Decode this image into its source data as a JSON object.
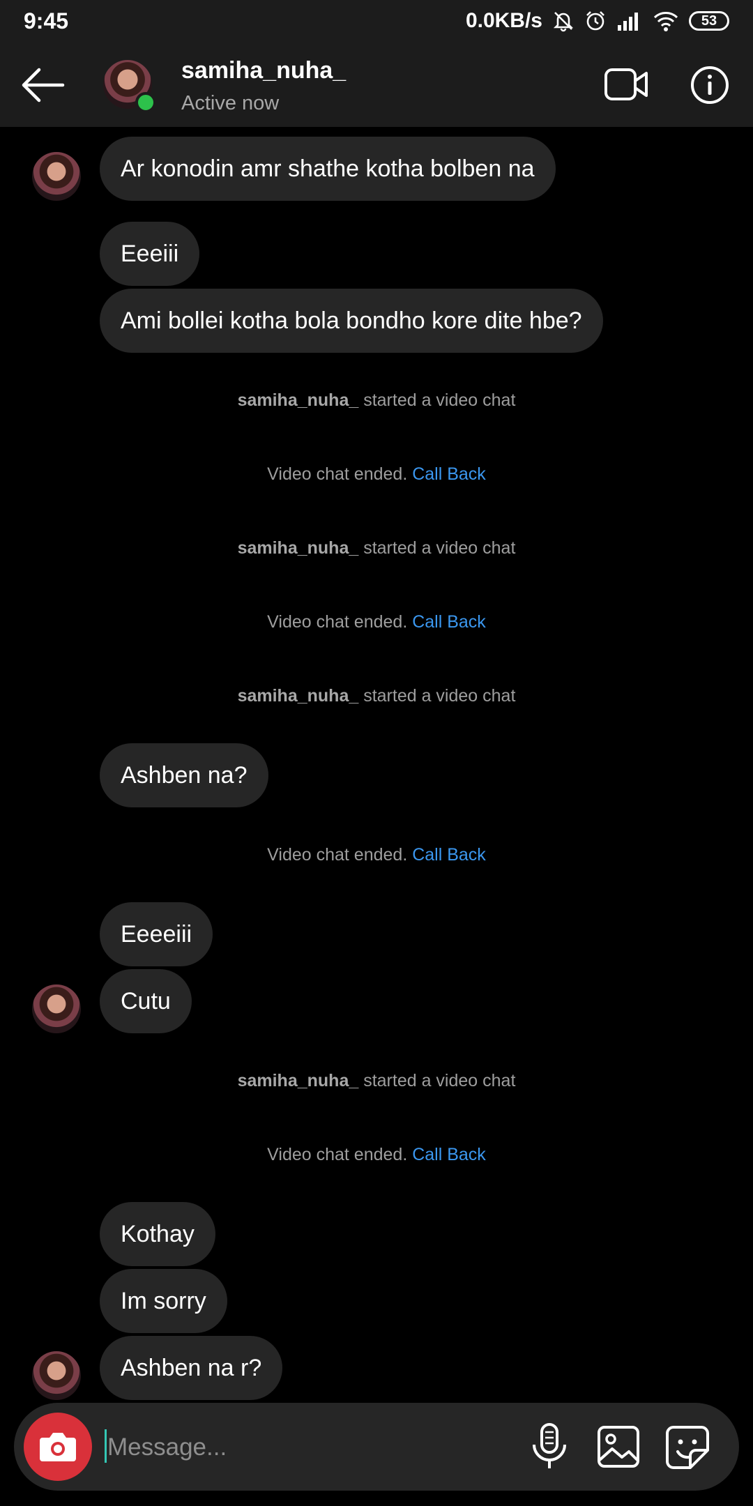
{
  "status_bar": {
    "time": "9:45",
    "network_speed": "0.0KB/s",
    "battery": "53"
  },
  "header": {
    "username": "samiha_nuha_",
    "status": "Active now",
    "online_color": "#2dc14b"
  },
  "messages": [
    {
      "type": "bubble",
      "text": "Ar konodin amr shathe kotha bolben na",
      "avatar": true
    },
    {
      "type": "bubble",
      "text": "Eeeiii",
      "avatar": false
    },
    {
      "type": "bubble",
      "text": "Ami bollei kotha bola bondho kore dite hbe?",
      "avatar": false
    },
    {
      "type": "event",
      "actor": "samiha_nuha_",
      "text": " started a video chat"
    },
    {
      "type": "event",
      "text": "Video chat ended. ",
      "link": "Call Back"
    },
    {
      "type": "event",
      "actor": "samiha_nuha_",
      "text": " started a video chat"
    },
    {
      "type": "event",
      "text": "Video chat ended. ",
      "link": "Call Back"
    },
    {
      "type": "event",
      "actor": "samiha_nuha_",
      "text": " started a video chat"
    },
    {
      "type": "bubble",
      "text": "Ashben na?",
      "avatar": false
    },
    {
      "type": "event",
      "text": "Video chat ended. ",
      "link": "Call Back"
    },
    {
      "type": "bubble",
      "text": "Eeeeiii",
      "avatar": false
    },
    {
      "type": "bubble",
      "text": "Cutu",
      "avatar": true
    },
    {
      "type": "event",
      "actor": "samiha_nuha_",
      "text": " started a video chat"
    },
    {
      "type": "event",
      "text": "Video chat ended. ",
      "link": "Call Back"
    },
    {
      "type": "bubble",
      "text": "Kothay",
      "avatar": false
    },
    {
      "type": "bubble",
      "text": "Im sorry",
      "avatar": false
    },
    {
      "type": "bubble",
      "text": "Ashben na r?",
      "avatar": true
    }
  ],
  "composer": {
    "placeholder": "Message..."
  },
  "colors": {
    "accent_link": "#3b97ef",
    "camera_button": "#d9313a",
    "bubble": "#262626"
  },
  "icons": [
    "back-arrow-icon",
    "video-camera-icon",
    "info-icon",
    "camera-icon",
    "microphone-icon",
    "gallery-icon",
    "sticker-icon",
    "mute-bell-icon",
    "alarm-icon",
    "signal-icon",
    "wifi-icon",
    "battery-icon"
  ]
}
